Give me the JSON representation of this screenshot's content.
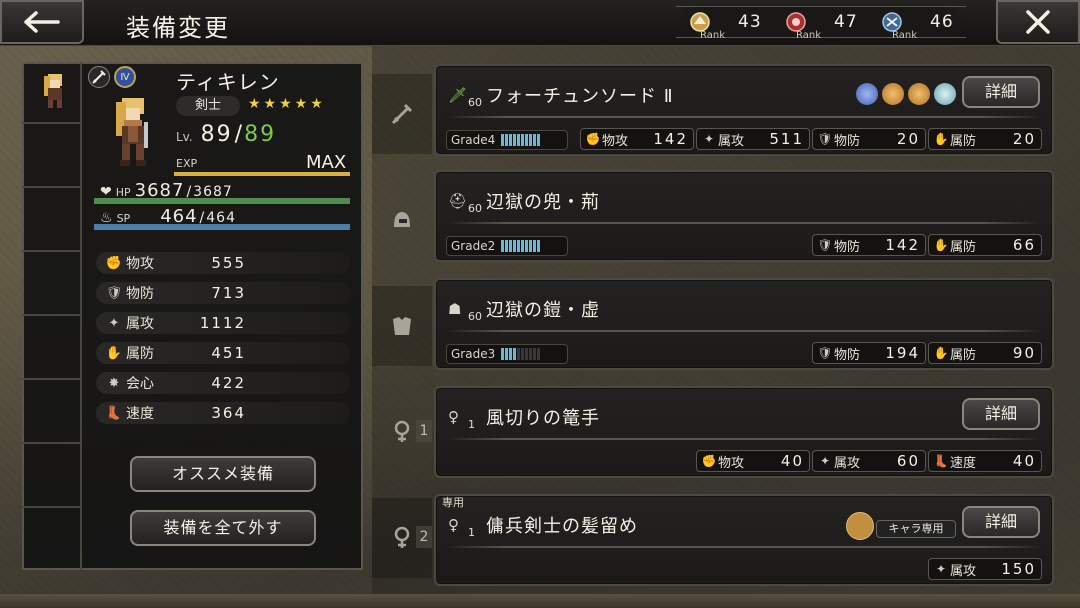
{
  "header": {
    "title": "装備変更",
    "ranks": [
      {
        "icon": "gold-rank-icon",
        "sub": "Rank",
        "value": "43"
      },
      {
        "icon": "red-rank-icon",
        "sub": "Rank",
        "value": "47"
      },
      {
        "icon": "blue-rank-icon",
        "sub": "Rank",
        "value": "46"
      }
    ]
  },
  "character": {
    "name": "ティキレン",
    "job": "剣士",
    "stars": "★★★★★",
    "level_label": "Lv.",
    "level": "89",
    "level_sep": "/",
    "level_max": "89",
    "exp_label": "EXP",
    "exp_value": "MAX",
    "hp_label": "HP",
    "hp": "3687",
    "hp_max": "3687",
    "sp_label": "SP",
    "sp": "464",
    "sp_max": "464",
    "stats": [
      {
        "name": "物攻",
        "value": "555"
      },
      {
        "name": "物防",
        "value": "713"
      },
      {
        "name": "属攻",
        "value": "1112"
      },
      {
        "name": "属防",
        "value": "451"
      },
      {
        "name": "会心",
        "value": "422"
      },
      {
        "name": "速度",
        "value": "364"
      }
    ],
    "buttons": {
      "recommend": "オススメ装備",
      "remove_all": "装備を全て外す"
    }
  },
  "equipment": [
    {
      "level": "60",
      "name": "フォーチュンソード Ⅱ",
      "detail": "詳細",
      "grade": "Grade4",
      "grade_level": 10,
      "stats": [
        {
          "name": "物攻",
          "value": "142"
        },
        {
          "name": "属攻",
          "value": "511"
        },
        {
          "name": "物防",
          "value": "20"
        },
        {
          "name": "属防",
          "value": "20"
        }
      ]
    },
    {
      "level": "60",
      "name": "辺獄の兜・荊",
      "grade": "Grade2",
      "grade_level": 10,
      "stats": [
        {
          "name": "物防",
          "value": "142"
        },
        {
          "name": "属防",
          "value": "66"
        }
      ]
    },
    {
      "level": "60",
      "name": "辺獄の鎧・虚",
      "grade": "Grade3",
      "grade_level": 4,
      "stats": [
        {
          "name": "物防",
          "value": "194"
        },
        {
          "name": "属防",
          "value": "90"
        }
      ]
    },
    {
      "slot": "1",
      "level": "1",
      "name": "風切りの篭手",
      "detail": "詳細",
      "stats": [
        {
          "name": "物攻",
          "value": "40"
        },
        {
          "name": "属攻",
          "value": "60"
        },
        {
          "name": "速度",
          "value": "40"
        }
      ]
    },
    {
      "slot": "2",
      "tag": "専用",
      "level": "1",
      "name": "傭兵剣士の髪留め",
      "chara_only": "キャラ専用",
      "detail": "詳細",
      "stats": [
        {
          "name": "属攻",
          "value": "150"
        }
      ]
    }
  ]
}
